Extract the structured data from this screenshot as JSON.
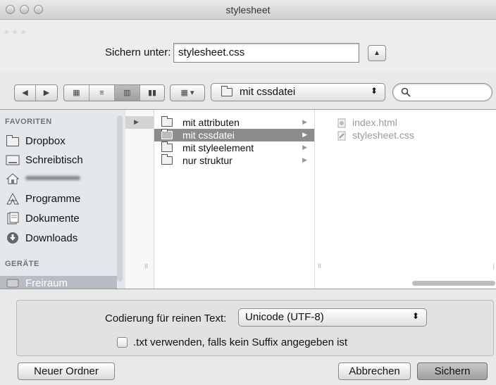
{
  "window": {
    "title": "stylesheet"
  },
  "save": {
    "label": "Sichern unter:",
    "filename": "stylesheet.css",
    "expand_glyph": "▲"
  },
  "toolbar": {
    "back_glyph": "◀",
    "forward_glyph": "▶",
    "view_icons_glyph": "▦",
    "view_list_glyph": "≡",
    "view_columns_glyph": "▥",
    "view_coverflow_glyph": "▮▮",
    "arrange_glyph": "▦ ▾",
    "path_folder": "mit cssdatei",
    "path_stepper_glyph": "⬍",
    "search_placeholder": ""
  },
  "sidebar": {
    "favorites_header": "FAVORITEN",
    "devices_header": "GERÄTE",
    "items": [
      {
        "label": "Dropbox",
        "icon": "folder-icon"
      },
      {
        "label": "Schreibtisch",
        "icon": "desktop-icon"
      },
      {
        "label": "",
        "icon": "home-icon"
      },
      {
        "label": "Programme",
        "icon": "applications-icon"
      },
      {
        "label": "Dokumente",
        "icon": "documents-icon"
      },
      {
        "label": "Downloads",
        "icon": "downloads-icon"
      }
    ],
    "device": {
      "label": "Freiraum",
      "icon": "disk-icon"
    }
  },
  "columns": {
    "folders": [
      {
        "label": "mit attributen",
        "selected": false
      },
      {
        "label": "mit cssdatei",
        "selected": true
      },
      {
        "label": "mit styleelement",
        "selected": false
      },
      {
        "label": "nur struktur",
        "selected": false
      }
    ],
    "files": [
      {
        "label": "index.html"
      },
      {
        "label": "stylesheet.css"
      }
    ],
    "resize_glyph": "II"
  },
  "encoding": {
    "label": "Codierung für reinen Text:",
    "value": "Unicode (UTF-8)",
    "stepper_glyph": "⬍",
    "checkbox_label": ".txt verwenden, falls kein Suffix angegeben ist",
    "checkbox_checked": false
  },
  "buttons": {
    "new_folder": "Neuer Ordner",
    "cancel": "Abbrechen",
    "save": "Sichern"
  }
}
